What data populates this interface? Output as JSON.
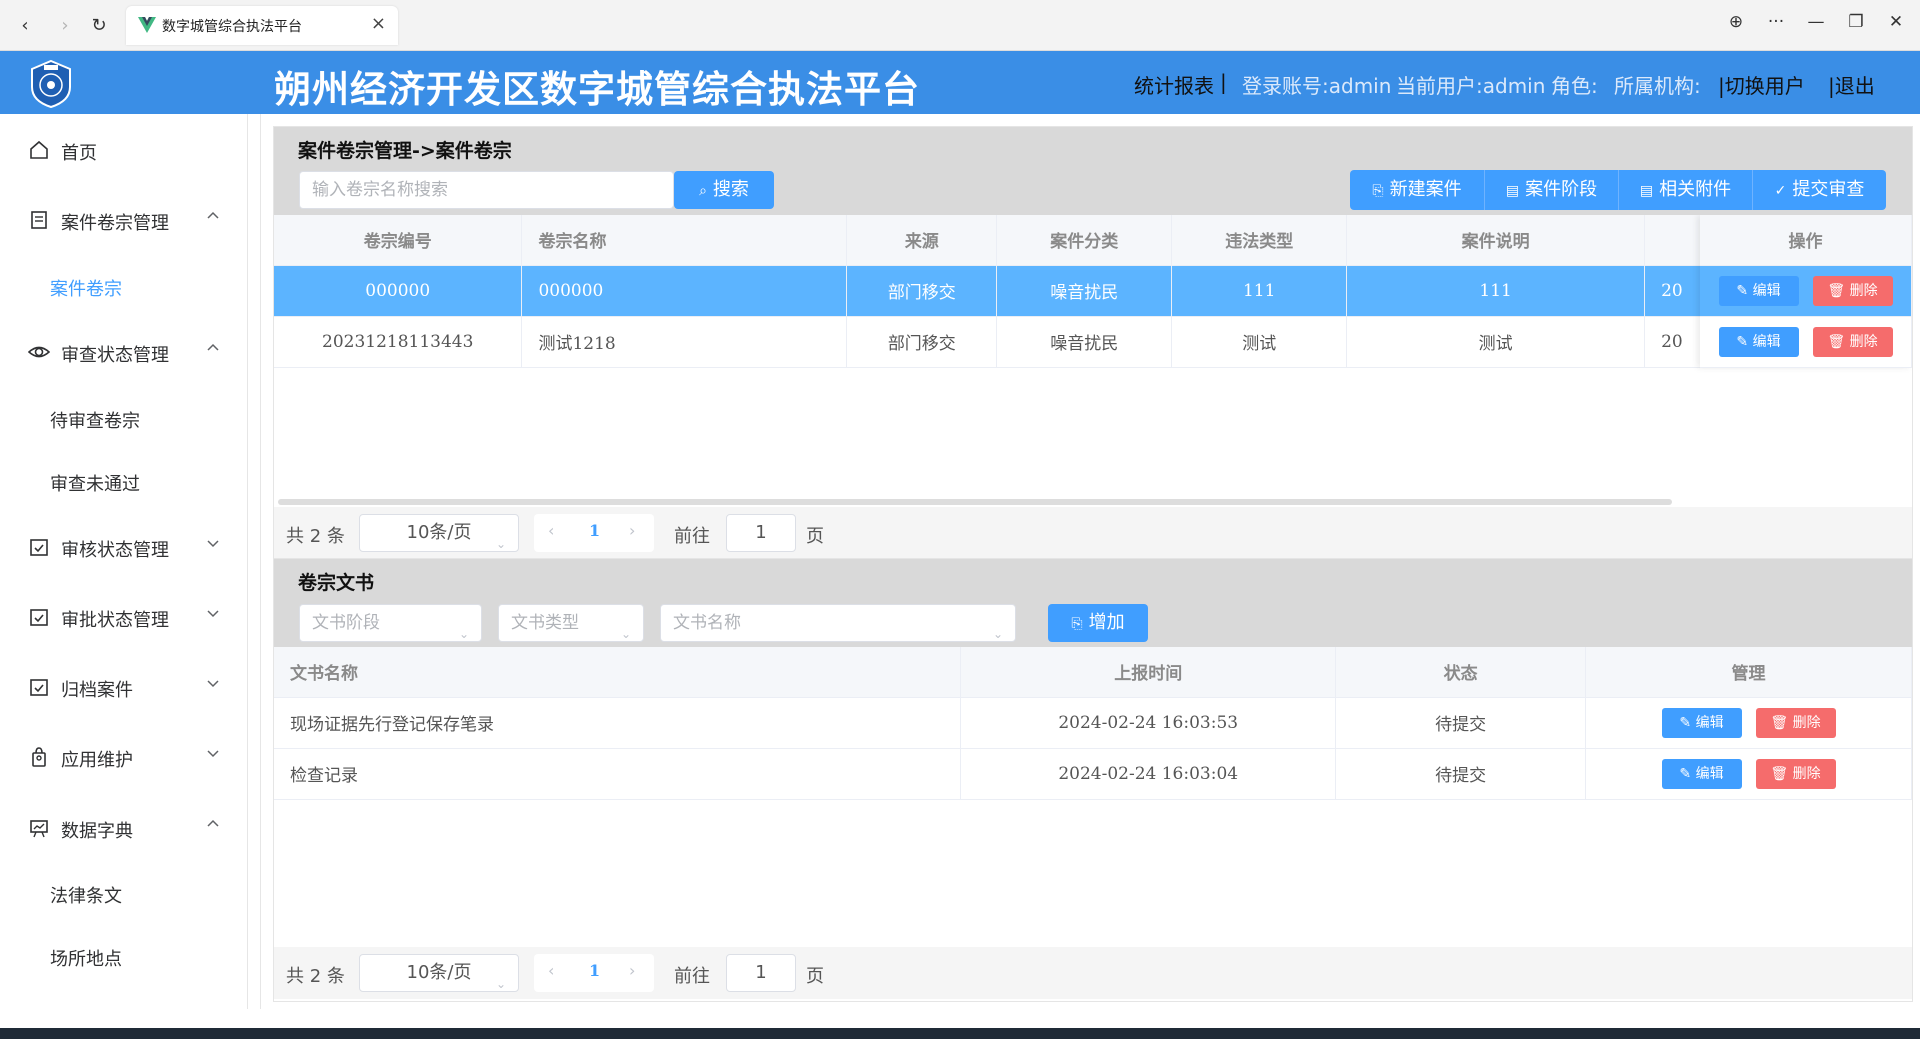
{
  "browser": {
    "tab_title": "数字城管综合执法平台",
    "back_icon": "‹",
    "forward_icon": "›",
    "refresh_icon": "↻",
    "close_icon": "×",
    "globe_icon": "⊕",
    "more_icon": "···",
    "minimize_icon": "—",
    "restore_icon": "❐",
    "window_close_icon": "✕"
  },
  "header": {
    "title": "朔州经济开发区数字城管综合执法平台",
    "stats_link": "统计报表",
    "sep1": "|",
    "login_account": "登录账号:admin",
    "current_user": "当前用户:admin",
    "role": "角色:",
    "org": "所属机构:",
    "switch_user": "|切换用户",
    "logout": "|退出",
    "accent_color": "#3a8ee6"
  },
  "sidebar": {
    "home": "首页",
    "case_mgmt": "案件卷宗管理",
    "case_dossier": "案件卷宗",
    "review_mgmt": "审查状态管理",
    "pending_review": "待审查卷宗",
    "review_failed": "审查未通过",
    "audit_mgmt": "审核状态管理",
    "approve_mgmt": "审批状态管理",
    "archive": "归档案件",
    "app_maint": "应用维护",
    "data_dict": "数据字典",
    "law": "法律条文",
    "places": "场所地点"
  },
  "case_panel": {
    "title": "案件卷宗管理->案件卷宗",
    "search_placeholder": "输入卷宗名称搜索",
    "search_btn": "搜索",
    "new_case": "新建案件",
    "case_stage": "案件阶段",
    "attachments": "相关附件",
    "submit_review": "提交审查",
    "columns": [
      "卷宗编号",
      "卷宗名称",
      "来源",
      "案件分类",
      "违法类型",
      "案件说明",
      "操作"
    ],
    "rows": [
      {
        "id": "000000",
        "name": "000000",
        "source": "部门移交",
        "category": "噪音扰民",
        "type": "111",
        "desc": "111",
        "extra": "20"
      },
      {
        "id": "20231218113443",
        "name": "测试1218",
        "source": "部门移交",
        "category": "噪音扰民",
        "type": "测试",
        "desc": "测试",
        "extra": "20"
      }
    ],
    "edit_label": "编辑",
    "delete_label": "删除"
  },
  "pager1": {
    "total": "共 2 条",
    "page_size": "10条/页",
    "current": "1",
    "goto": "前往",
    "goto_value": "1",
    "page_unit": "页"
  },
  "doc_panel": {
    "title": "卷宗文书",
    "stage_placeholder": "文书阶段",
    "type_placeholder": "文书类型",
    "name_placeholder": "文书名称",
    "add_btn": "增加",
    "columns": [
      "文书名称",
      "上报时间",
      "状态",
      "管理"
    ],
    "rows": [
      {
        "name": "现场证据先行登记保存笔录",
        "time": "2024-02-24 16:03:53",
        "status": "待提交"
      },
      {
        "name": "检查记录",
        "time": "2024-02-24 16:03:04",
        "status": "待提交"
      }
    ],
    "edit_label": "编辑",
    "delete_label": "删除"
  },
  "pager2": {
    "total": "共 2 条",
    "page_size": "10条/页",
    "current": "1",
    "goto": "前往",
    "goto_value": "1",
    "page_unit": "页"
  }
}
